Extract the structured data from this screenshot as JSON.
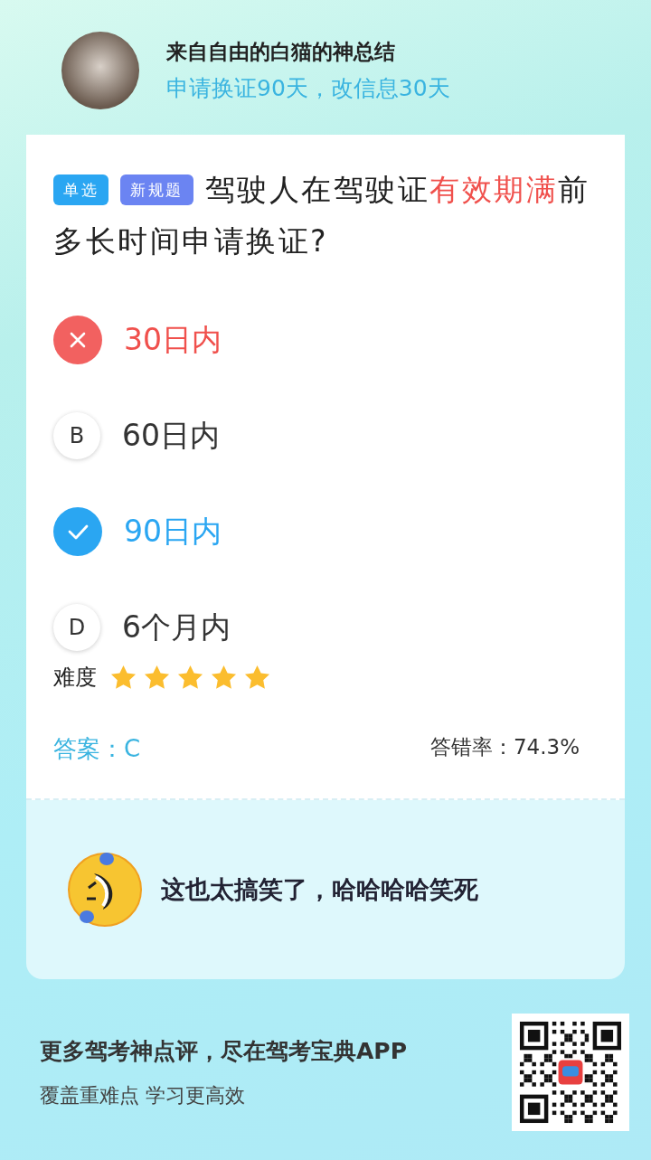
{
  "header": {
    "author": "来自自由的白猫的神总结",
    "summary": "申请换证90天，改信息30天"
  },
  "question": {
    "tags": [
      {
        "label": "单选",
        "color": "#2aa6f2"
      },
      {
        "label": "新规题",
        "color": "#6b84f2"
      }
    ],
    "parts": [
      {
        "text": "驾驶人在驾驶证",
        "highlight": false
      },
      {
        "text": "有效期满",
        "highlight": true
      },
      {
        "text": "前多长时间申请换证?",
        "highlight": false
      }
    ],
    "options": [
      {
        "kind": "wrong",
        "text": "30日内"
      },
      {
        "kind": "normal",
        "letter": "B",
        "text": "60日内"
      },
      {
        "kind": "correct",
        "text": "90日内"
      },
      {
        "kind": "normal",
        "letter": "D",
        "text": "6个月内"
      }
    ],
    "difficulty_label": "难度",
    "stars": 5,
    "answer": "答案：C",
    "error_rate": "答错率：74.3%"
  },
  "comment": {
    "text": "这也太搞笑了，哈哈哈哈笑死"
  },
  "footer": {
    "title": "更多驾考神点评，尽在驾考宝典APP",
    "subtitle": "覆盖重难点 学习更高效"
  }
}
